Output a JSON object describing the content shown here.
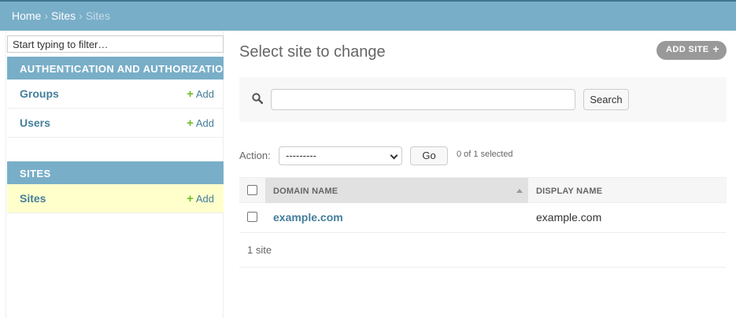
{
  "breadcrumbs": {
    "home": "Home",
    "app": "Sites",
    "current": "Sites",
    "separator": "›"
  },
  "sidebar": {
    "filter_placeholder": "Start typing to filter…",
    "modules": [
      {
        "caption": "AUTHENTICATION AND AUTHORIZATION",
        "items": [
          {
            "label": "Groups",
            "add_label": "Add"
          },
          {
            "label": "Users",
            "add_label": "Add"
          }
        ]
      },
      {
        "caption": "SITES",
        "items": [
          {
            "label": "Sites",
            "add_label": "Add",
            "current": true
          }
        ]
      }
    ]
  },
  "main": {
    "title": "Select site to change",
    "add_button": "ADD SITE",
    "add_icon": "+",
    "search": {
      "value": "",
      "button": "Search",
      "icon": "search-icon"
    },
    "actions": {
      "label": "Action:",
      "selected_option": "---------",
      "go_button": "Go",
      "selected_count": "0 of 1 selected"
    },
    "table": {
      "columns": [
        "DOMAIN NAME",
        "DISPLAY NAME"
      ],
      "sorted_column": "DOMAIN NAME",
      "sort_direction": "ascending",
      "rows": [
        {
          "domain_name": "example.com",
          "display_name": "example.com"
        }
      ],
      "paginator": "1 site"
    }
  },
  "colors": {
    "header": "#79aec8",
    "header_border": "#417690",
    "link": "#447e9b",
    "add_plus": "#70bf2b",
    "current_row": "#ffffcc",
    "sorted_header": "#e1e1e1"
  }
}
